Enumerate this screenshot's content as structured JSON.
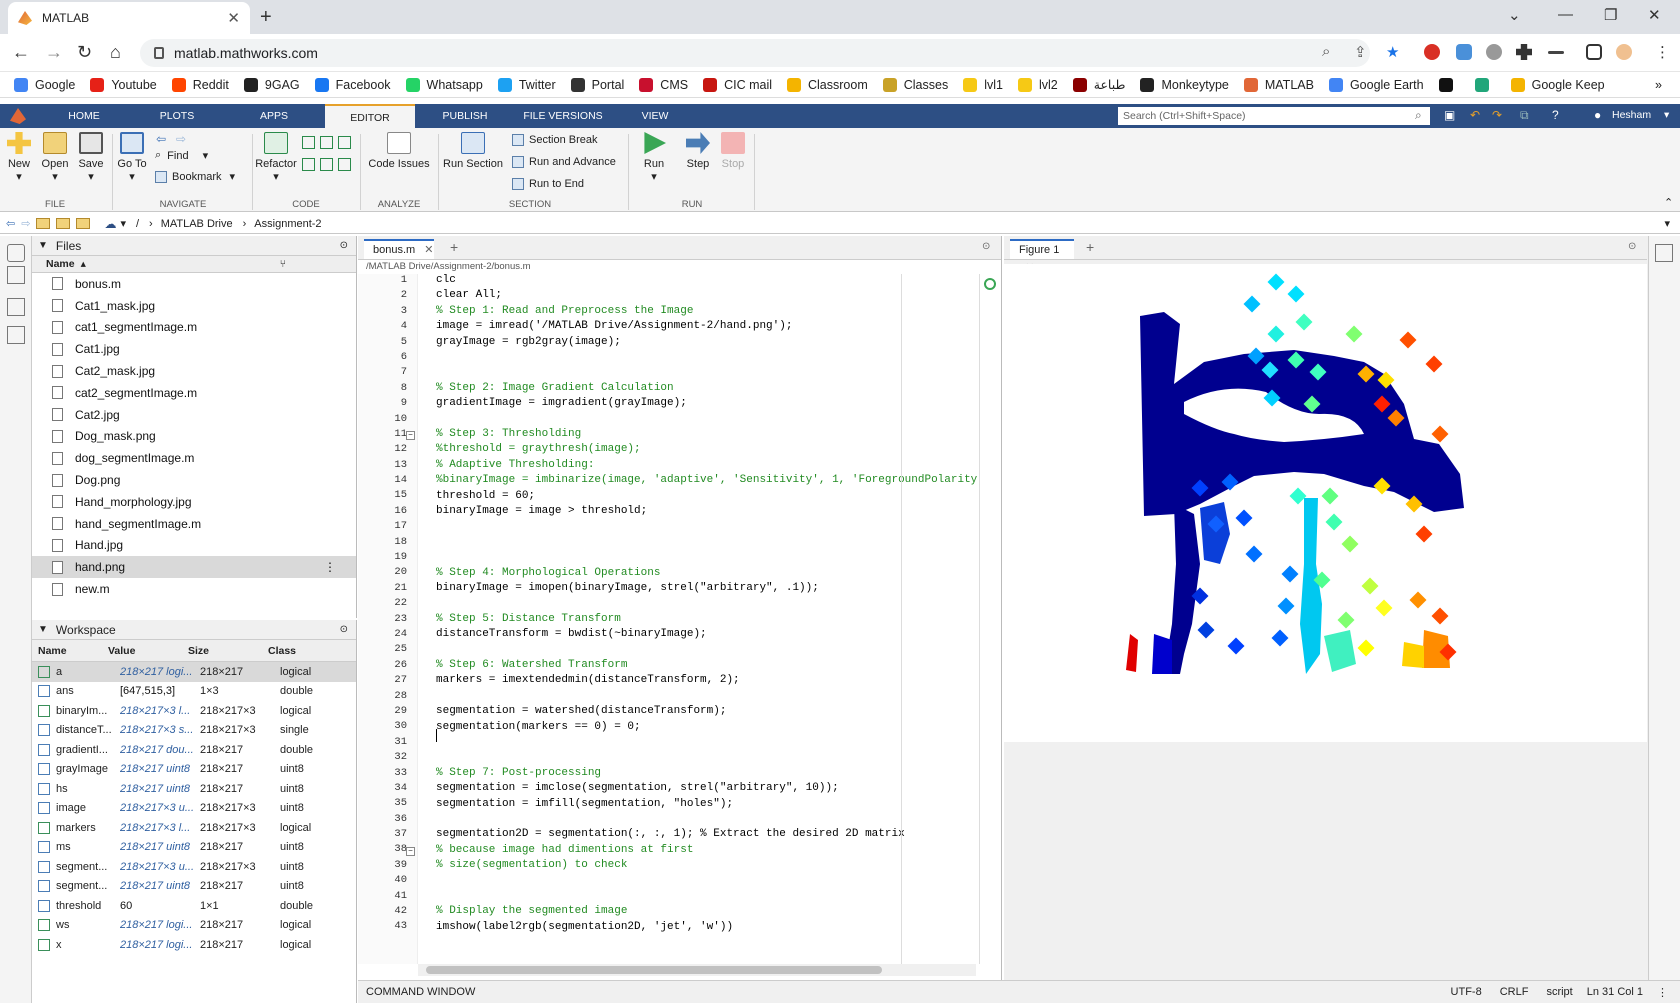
{
  "browser": {
    "tab_title": "MATLAB",
    "url": "matlab.mathworks.com",
    "bookmarks": [
      "Google",
      "Youtube",
      "Reddit",
      "9GAG",
      "Facebook",
      "Whatsapp",
      "Twitter",
      "Portal",
      "CMS",
      "CIC mail",
      "Classroom",
      "Classes",
      "lvl1",
      "lvl2",
      "طباعة",
      "Monkeytype",
      "MATLAB",
      "Google Earth",
      "",
      "",
      "Google Keep"
    ],
    "bookmark_colors": [
      "#4285f4",
      "#e62117",
      "#ff4500",
      "#222222",
      "#1877f2",
      "#25d366",
      "#1da1f2",
      "#333333",
      "#c8102e",
      "#c71610",
      "#f4b400",
      "#c9a227",
      "#f6c915",
      "#f6c915",
      "#8b0000",
      "#222222",
      "#e16737",
      "#4285f4",
      "#111111",
      "#21a67a",
      "#f4b400"
    ]
  },
  "matlab": {
    "tabs": [
      "HOME",
      "PLOTS",
      "APPS",
      "EDITOR",
      "PUBLISH",
      "FILE VERSIONS",
      "VIEW"
    ],
    "search_placeholder": "Search (Ctrl+Shift+Space)",
    "user": "Hesham",
    "ribbon": {
      "new": "New",
      "open": "Open",
      "save": "Save",
      "goto": "Go To",
      "find": "Find",
      "bookmark": "Bookmark",
      "refactor": "Refactor",
      "code_issues": "Code Issues",
      "run_section": "Run Section",
      "section_break": "Section Break",
      "run_and_advance": "Run and Advance",
      "run_to_end": "Run to End",
      "run": "Run",
      "step": "Step",
      "stop": "Stop",
      "groups": [
        "FILE",
        "NAVIGATE",
        "CODE",
        "ANALYZE",
        "SECTION",
        "RUN"
      ]
    },
    "path": [
      "/",
      "MATLAB Drive",
      "Assignment-2"
    ],
    "files": {
      "title": "Files",
      "col_name": "Name",
      "items": [
        "bonus.m",
        "Cat1_mask.jpg",
        "cat1_segmentImage.m",
        "Cat1.jpg",
        "Cat2_mask.jpg",
        "cat2_segmentImage.m",
        "Cat2.jpg",
        "Dog_mask.png",
        "dog_segmentImage.m",
        "Dog.png",
        "Hand_morphology.jpg",
        "hand_segmentImage.m",
        "Hand.jpg",
        "hand.png",
        "new.m"
      ]
    },
    "workspace": {
      "title": "Workspace",
      "cols": [
        "Name",
        "Value",
        "Size",
        "Class"
      ],
      "rows": [
        [
          "a",
          "218×217 logi...",
          "218×217",
          "logical"
        ],
        [
          "ans",
          "[647,515,3]",
          "1×3",
          "double"
        ],
        [
          "binaryIm...",
          "218×217×3 l...",
          "218×217×3",
          "logical"
        ],
        [
          "distanceT...",
          "218×217×3 s...",
          "218×217×3",
          "single"
        ],
        [
          "gradientI...",
          "218×217 dou...",
          "218×217",
          "double"
        ],
        [
          "grayImage",
          "218×217 uint8",
          "218×217",
          "uint8"
        ],
        [
          "hs",
          "218×217 uint8",
          "218×217",
          "uint8"
        ],
        [
          "image",
          "218×217×3 u...",
          "218×217×3",
          "uint8"
        ],
        [
          "markers",
          "218×217×3 l...",
          "218×217×3",
          "logical"
        ],
        [
          "ms",
          "218×217 uint8",
          "218×217",
          "uint8"
        ],
        [
          "segment...",
          "218×217×3 u...",
          "218×217×3",
          "uint8"
        ],
        [
          "segment...",
          "218×217 uint8",
          "218×217",
          "uint8"
        ],
        [
          "threshold",
          "60",
          "1×1",
          "double"
        ],
        [
          "ws",
          "218×217 logi...",
          "218×217",
          "logical"
        ],
        [
          "x",
          "218×217 logi...",
          "218×217",
          "logical"
        ]
      ]
    },
    "editor": {
      "tab": "bonus.m",
      "filepath": "/MATLAB Drive/Assignment-2/bonus.m",
      "lines": [
        "clc",
        "clear All;",
        "% Step 1: Read and Preprocess the Image",
        "image = imread('/MATLAB Drive/Assignment-2/hand.png');",
        "grayImage = rgb2gray(image);",
        "",
        "",
        "% Step 2: Image Gradient Calculation",
        "gradientImage = imgradient(grayImage);",
        "",
        "% Step 3: Thresholding",
        "%threshold = graythresh(image);",
        "% Adaptive Thresholding:",
        "%binaryImage = imbinarize(image, 'adaptive', 'Sensitivity', 1, 'ForegroundPolarity",
        "threshold = 60;",
        "binaryImage = image > threshold;",
        "",
        "",
        "",
        "% Step 4: Morphological Operations",
        "binaryImage = imopen(binaryImage, strel(\"arbitrary\", .1));",
        "",
        "% Step 5: Distance Transform",
        "distanceTransform = bwdist(~binaryImage);",
        "",
        "% Step 6: Watershed Transform",
        "markers = imextendedmin(distanceTransform, 2);",
        "",
        "segmentation = watershed(distanceTransform);",
        "segmentation(markers == 0) = 0;",
        "",
        "",
        "% Step 7: Post-processing",
        "segmentation = imclose(segmentation, strel(\"arbitrary\", 10));",
        "segmentation = imfill(segmentation, \"holes\");",
        "",
        "segmentation2D = segmentation(:, :, 1); % Extract the desired 2D matrix",
        "% because image had dimentions at first",
        "% size(segmentation) to check",
        "",
        "",
        "% Display the segmented image",
        "imshow(label2rgb(segmentation2D, 'jet', 'w'))"
      ]
    },
    "figure": {
      "tab": "Figure 1"
    },
    "command_window": "COMMAND WINDOW",
    "status": [
      "UTF-8",
      "CRLF",
      "script",
      "Ln 31 Col 1"
    ]
  }
}
